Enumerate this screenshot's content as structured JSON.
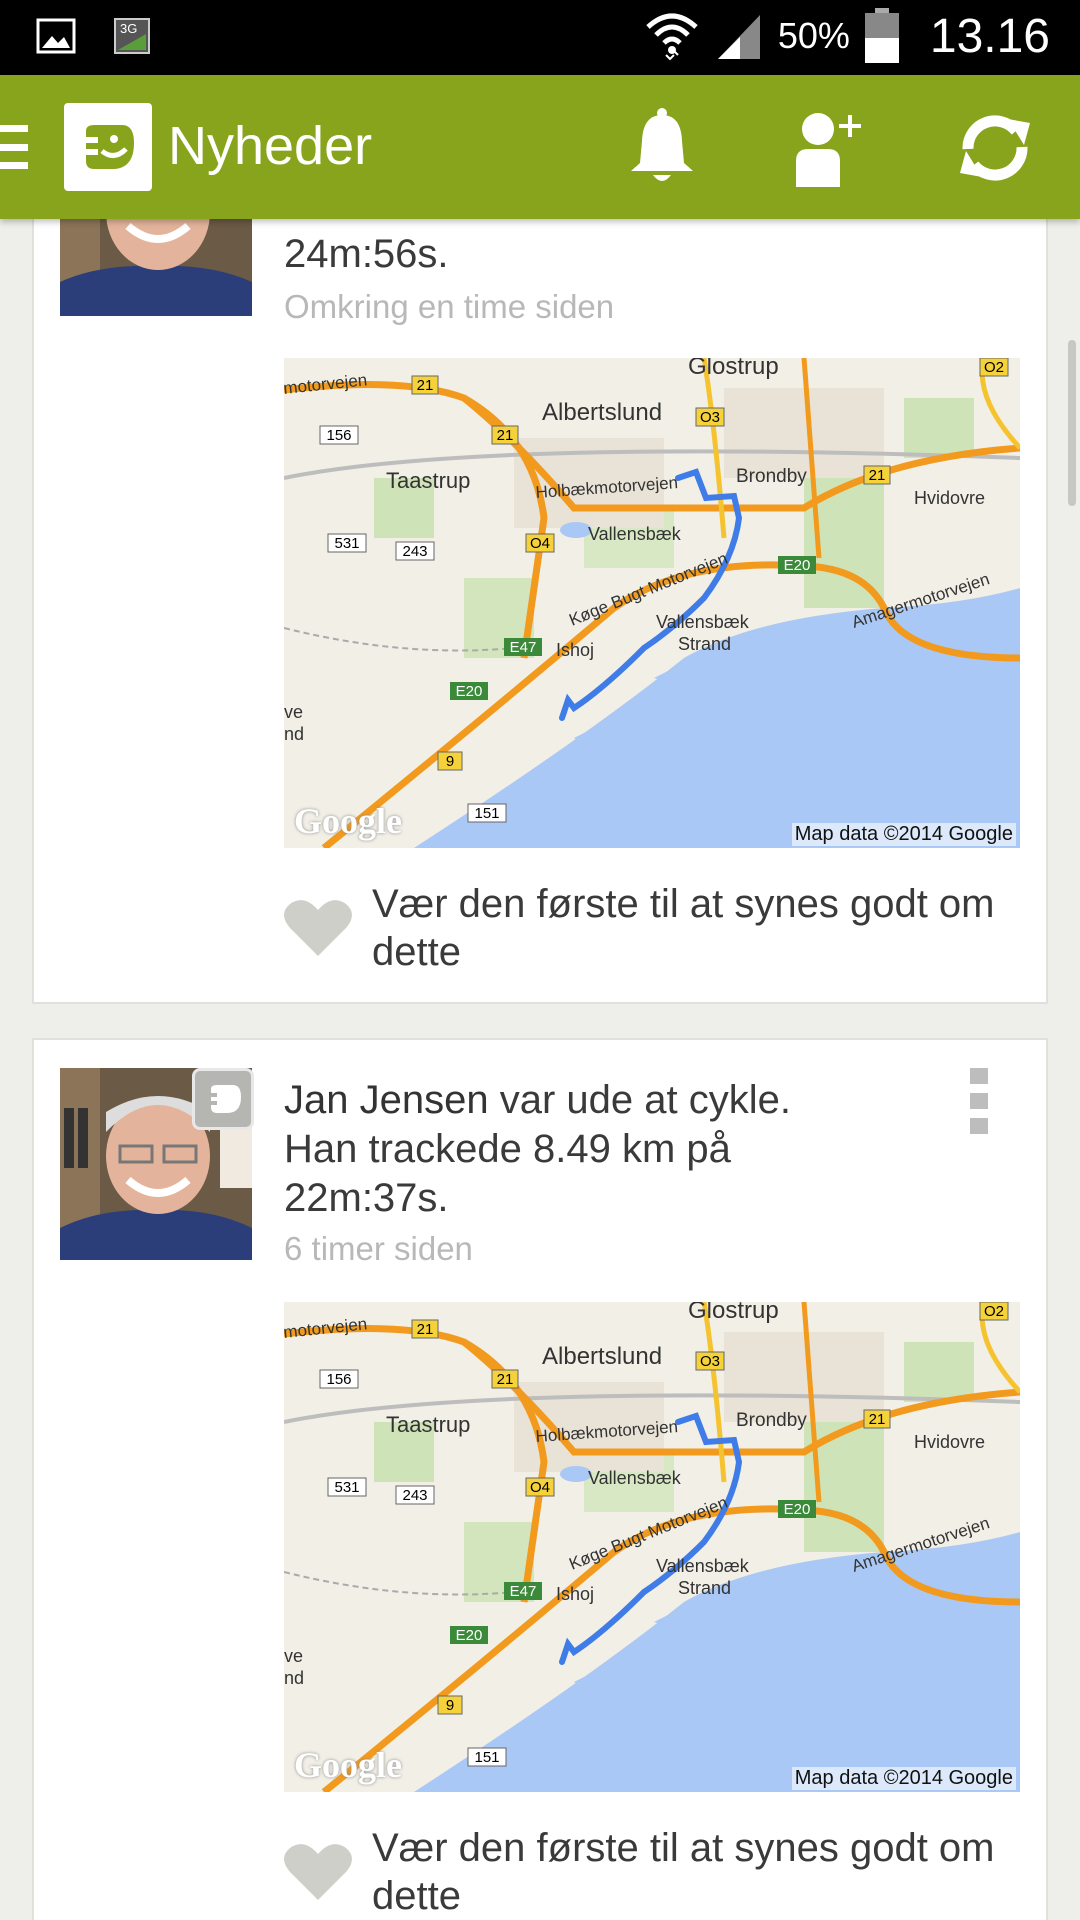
{
  "status_bar": {
    "battery": "50%",
    "time": "13.16",
    "network": "3G"
  },
  "action_bar": {
    "title": "Nyheder",
    "icons": [
      "menu-icon",
      "app-logo-icon",
      "bell-icon",
      "add-friend-icon",
      "refresh-icon"
    ]
  },
  "feed": {
    "items": [
      {
        "text_tail": "24m:56s.",
        "time": "Omkring en time siden",
        "map_credit": "Map data ©2014 Google",
        "watermark": "Google",
        "like_text": "Vær den første til at synes godt om dette"
      },
      {
        "author": "Jan Jensen",
        "action": "var ude at cykle.",
        "line2": "Han trackede 8.49 km på",
        "line3": "22m:37s.",
        "time": "6 timer siden",
        "map_credit": "Map data ©2014 Google",
        "watermark": "Google",
        "like_text": "Vær den første til at synes godt om dette"
      }
    ]
  },
  "map_labels": {
    "glostrup": "Glostrup",
    "albertslund": "Albertslund",
    "taastrup": "Taastrup",
    "brondby": "Brondby",
    "hvidovre": "Hvidovre",
    "vallensbaek": "Vallensbæk",
    "vallensbaek_strand_1": "Vallensbæk",
    "vallensbaek_strand_2": "Strand",
    "ishoj": "Ishoj",
    "holbaek": "Holbækmotorvejen",
    "koge": "Køge Bugt Motorvejen",
    "amager": "Amagermotorvejen",
    "motorvejen": "motorvejen",
    "ve": "ve",
    "nd": "nd",
    "r21": "21",
    "r156": "156",
    "r531": "531",
    "r243": "243",
    "r04": "O4",
    "r03": "O3",
    "r02": "O2",
    "e47": "E47",
    "e20": "E20",
    "r9": "9",
    "r151": "151"
  },
  "colors": {
    "action_bar": "#88a41c",
    "route": "#3f7ce8",
    "water": "#a9c8f5",
    "motorway": "#f29a1d"
  }
}
